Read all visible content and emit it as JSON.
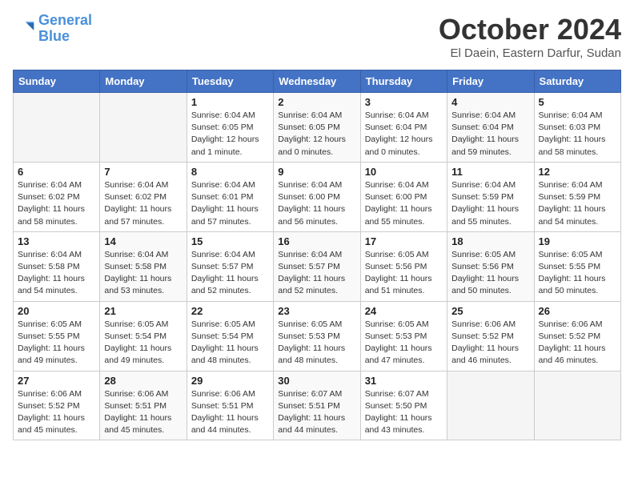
{
  "logo": {
    "line1": "General",
    "line2": "Blue"
  },
  "title": "October 2024",
  "location": "El Daein, Eastern Darfur, Sudan",
  "weekdays": [
    "Sunday",
    "Monday",
    "Tuesday",
    "Wednesday",
    "Thursday",
    "Friday",
    "Saturday"
  ],
  "weeks": [
    [
      {
        "day": "",
        "info": ""
      },
      {
        "day": "",
        "info": ""
      },
      {
        "day": "1",
        "info": "Sunrise: 6:04 AM\nSunset: 6:05 PM\nDaylight: 12 hours\nand 1 minute."
      },
      {
        "day": "2",
        "info": "Sunrise: 6:04 AM\nSunset: 6:05 PM\nDaylight: 12 hours\nand 0 minutes."
      },
      {
        "day": "3",
        "info": "Sunrise: 6:04 AM\nSunset: 6:04 PM\nDaylight: 12 hours\nand 0 minutes."
      },
      {
        "day": "4",
        "info": "Sunrise: 6:04 AM\nSunset: 6:04 PM\nDaylight: 11 hours\nand 59 minutes."
      },
      {
        "day": "5",
        "info": "Sunrise: 6:04 AM\nSunset: 6:03 PM\nDaylight: 11 hours\nand 58 minutes."
      }
    ],
    [
      {
        "day": "6",
        "info": "Sunrise: 6:04 AM\nSunset: 6:02 PM\nDaylight: 11 hours\nand 58 minutes."
      },
      {
        "day": "7",
        "info": "Sunrise: 6:04 AM\nSunset: 6:02 PM\nDaylight: 11 hours\nand 57 minutes."
      },
      {
        "day": "8",
        "info": "Sunrise: 6:04 AM\nSunset: 6:01 PM\nDaylight: 11 hours\nand 57 minutes."
      },
      {
        "day": "9",
        "info": "Sunrise: 6:04 AM\nSunset: 6:00 PM\nDaylight: 11 hours\nand 56 minutes."
      },
      {
        "day": "10",
        "info": "Sunrise: 6:04 AM\nSunset: 6:00 PM\nDaylight: 11 hours\nand 55 minutes."
      },
      {
        "day": "11",
        "info": "Sunrise: 6:04 AM\nSunset: 5:59 PM\nDaylight: 11 hours\nand 55 minutes."
      },
      {
        "day": "12",
        "info": "Sunrise: 6:04 AM\nSunset: 5:59 PM\nDaylight: 11 hours\nand 54 minutes."
      }
    ],
    [
      {
        "day": "13",
        "info": "Sunrise: 6:04 AM\nSunset: 5:58 PM\nDaylight: 11 hours\nand 54 minutes."
      },
      {
        "day": "14",
        "info": "Sunrise: 6:04 AM\nSunset: 5:58 PM\nDaylight: 11 hours\nand 53 minutes."
      },
      {
        "day": "15",
        "info": "Sunrise: 6:04 AM\nSunset: 5:57 PM\nDaylight: 11 hours\nand 52 minutes."
      },
      {
        "day": "16",
        "info": "Sunrise: 6:04 AM\nSunset: 5:57 PM\nDaylight: 11 hours\nand 52 minutes."
      },
      {
        "day": "17",
        "info": "Sunrise: 6:05 AM\nSunset: 5:56 PM\nDaylight: 11 hours\nand 51 minutes."
      },
      {
        "day": "18",
        "info": "Sunrise: 6:05 AM\nSunset: 5:56 PM\nDaylight: 11 hours\nand 50 minutes."
      },
      {
        "day": "19",
        "info": "Sunrise: 6:05 AM\nSunset: 5:55 PM\nDaylight: 11 hours\nand 50 minutes."
      }
    ],
    [
      {
        "day": "20",
        "info": "Sunrise: 6:05 AM\nSunset: 5:55 PM\nDaylight: 11 hours\nand 49 minutes."
      },
      {
        "day": "21",
        "info": "Sunrise: 6:05 AM\nSunset: 5:54 PM\nDaylight: 11 hours\nand 49 minutes."
      },
      {
        "day": "22",
        "info": "Sunrise: 6:05 AM\nSunset: 5:54 PM\nDaylight: 11 hours\nand 48 minutes."
      },
      {
        "day": "23",
        "info": "Sunrise: 6:05 AM\nSunset: 5:53 PM\nDaylight: 11 hours\nand 48 minutes."
      },
      {
        "day": "24",
        "info": "Sunrise: 6:05 AM\nSunset: 5:53 PM\nDaylight: 11 hours\nand 47 minutes."
      },
      {
        "day": "25",
        "info": "Sunrise: 6:06 AM\nSunset: 5:52 PM\nDaylight: 11 hours\nand 46 minutes."
      },
      {
        "day": "26",
        "info": "Sunrise: 6:06 AM\nSunset: 5:52 PM\nDaylight: 11 hours\nand 46 minutes."
      }
    ],
    [
      {
        "day": "27",
        "info": "Sunrise: 6:06 AM\nSunset: 5:52 PM\nDaylight: 11 hours\nand 45 minutes."
      },
      {
        "day": "28",
        "info": "Sunrise: 6:06 AM\nSunset: 5:51 PM\nDaylight: 11 hours\nand 45 minutes."
      },
      {
        "day": "29",
        "info": "Sunrise: 6:06 AM\nSunset: 5:51 PM\nDaylight: 11 hours\nand 44 minutes."
      },
      {
        "day": "30",
        "info": "Sunrise: 6:07 AM\nSunset: 5:51 PM\nDaylight: 11 hours\nand 44 minutes."
      },
      {
        "day": "31",
        "info": "Sunrise: 6:07 AM\nSunset: 5:50 PM\nDaylight: 11 hours\nand 43 minutes."
      },
      {
        "day": "",
        "info": ""
      },
      {
        "day": "",
        "info": ""
      }
    ]
  ]
}
